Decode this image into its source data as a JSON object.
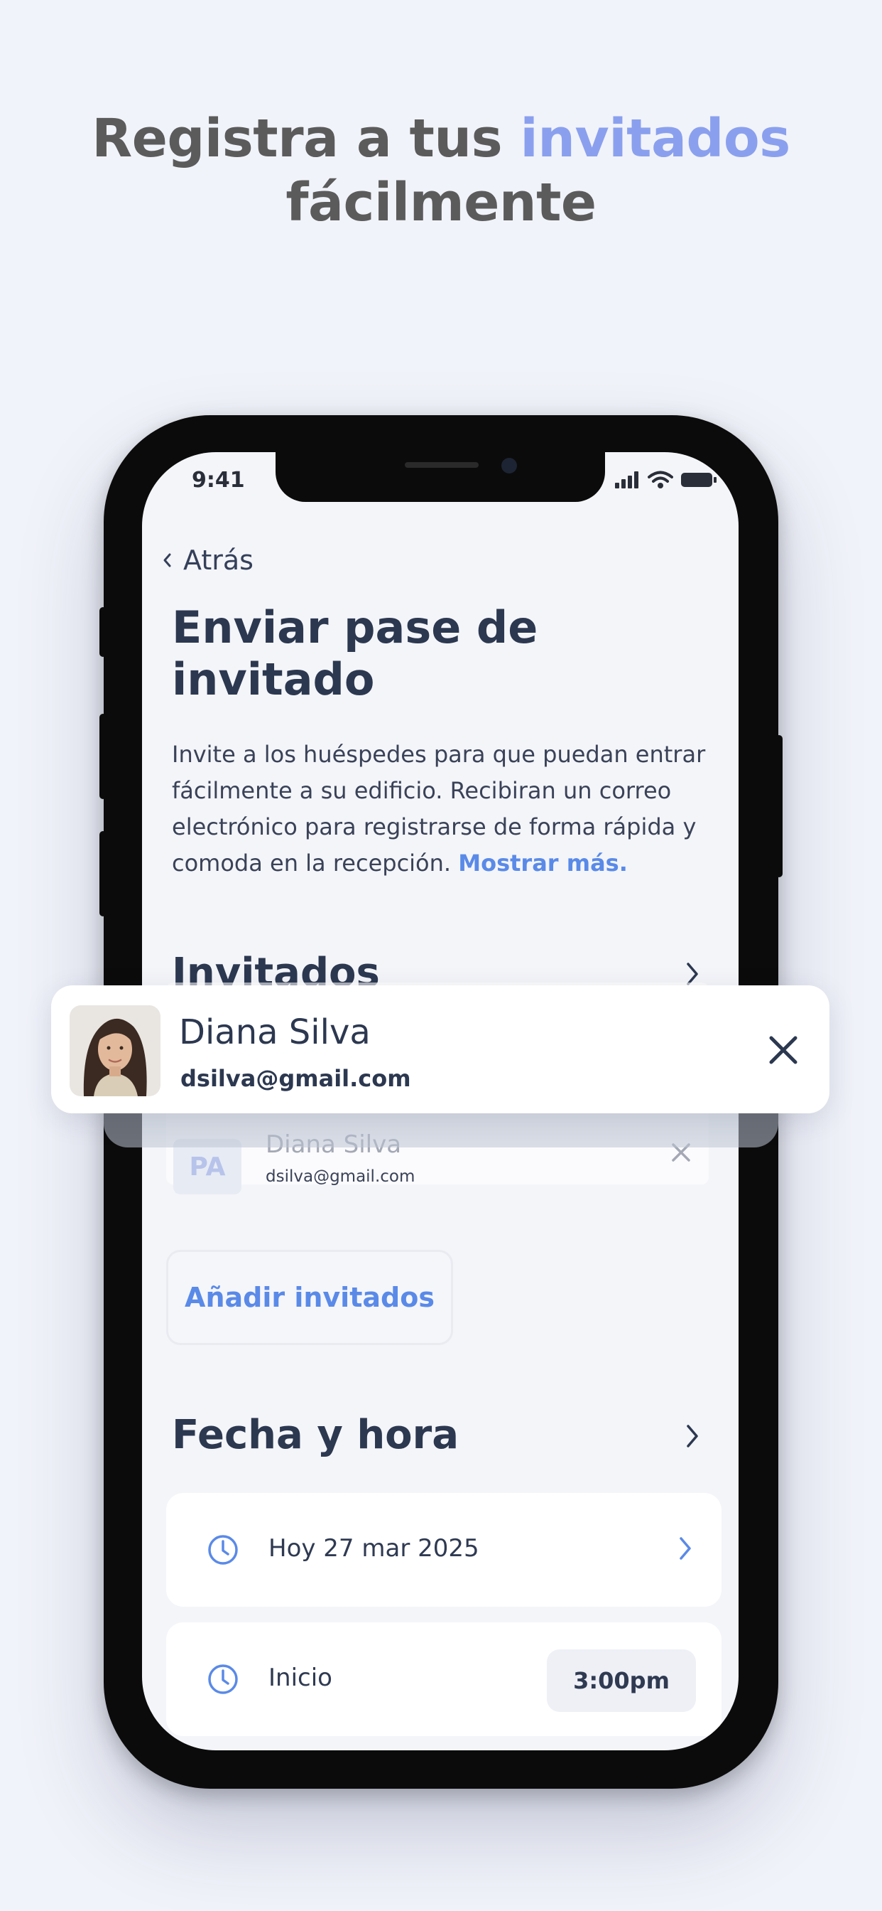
{
  "headline": {
    "line1_prefix": "Registra a tus ",
    "line1_accent": "invitados",
    "line2": "fácilmente"
  },
  "status_bar": {
    "time": "9:41"
  },
  "nav": {
    "back_label": "Atrás"
  },
  "page": {
    "title": "Enviar pase de invitado",
    "description": "Invite a los huéspedes para que puedan entrar fácilmente a su edificio. Recibiran un correo electrónico para registrarse de forma rápida y comoda en la recepción.",
    "show_more": "Mostrar más."
  },
  "guests": {
    "section_title": "Invitados",
    "featured": {
      "name": "Diana Silva",
      "email": "dsilva@gmail.com"
    },
    "faded": {
      "initials": "PA",
      "name": "Diana Silva",
      "email": "dsilva@gmail.com",
      "ghost_email": "dsilva@gmail.com"
    },
    "add_button": "Añadir invitados"
  },
  "datetime": {
    "section_title": "Fecha y hora",
    "date_label": "Hoy 27 mar 2025",
    "start_label": "Inicio",
    "start_time": "3:00pm"
  },
  "colors": {
    "accent": "#5a8ae8",
    "headline_accent": "#8aa0ee",
    "text_dark": "#2c3850"
  }
}
